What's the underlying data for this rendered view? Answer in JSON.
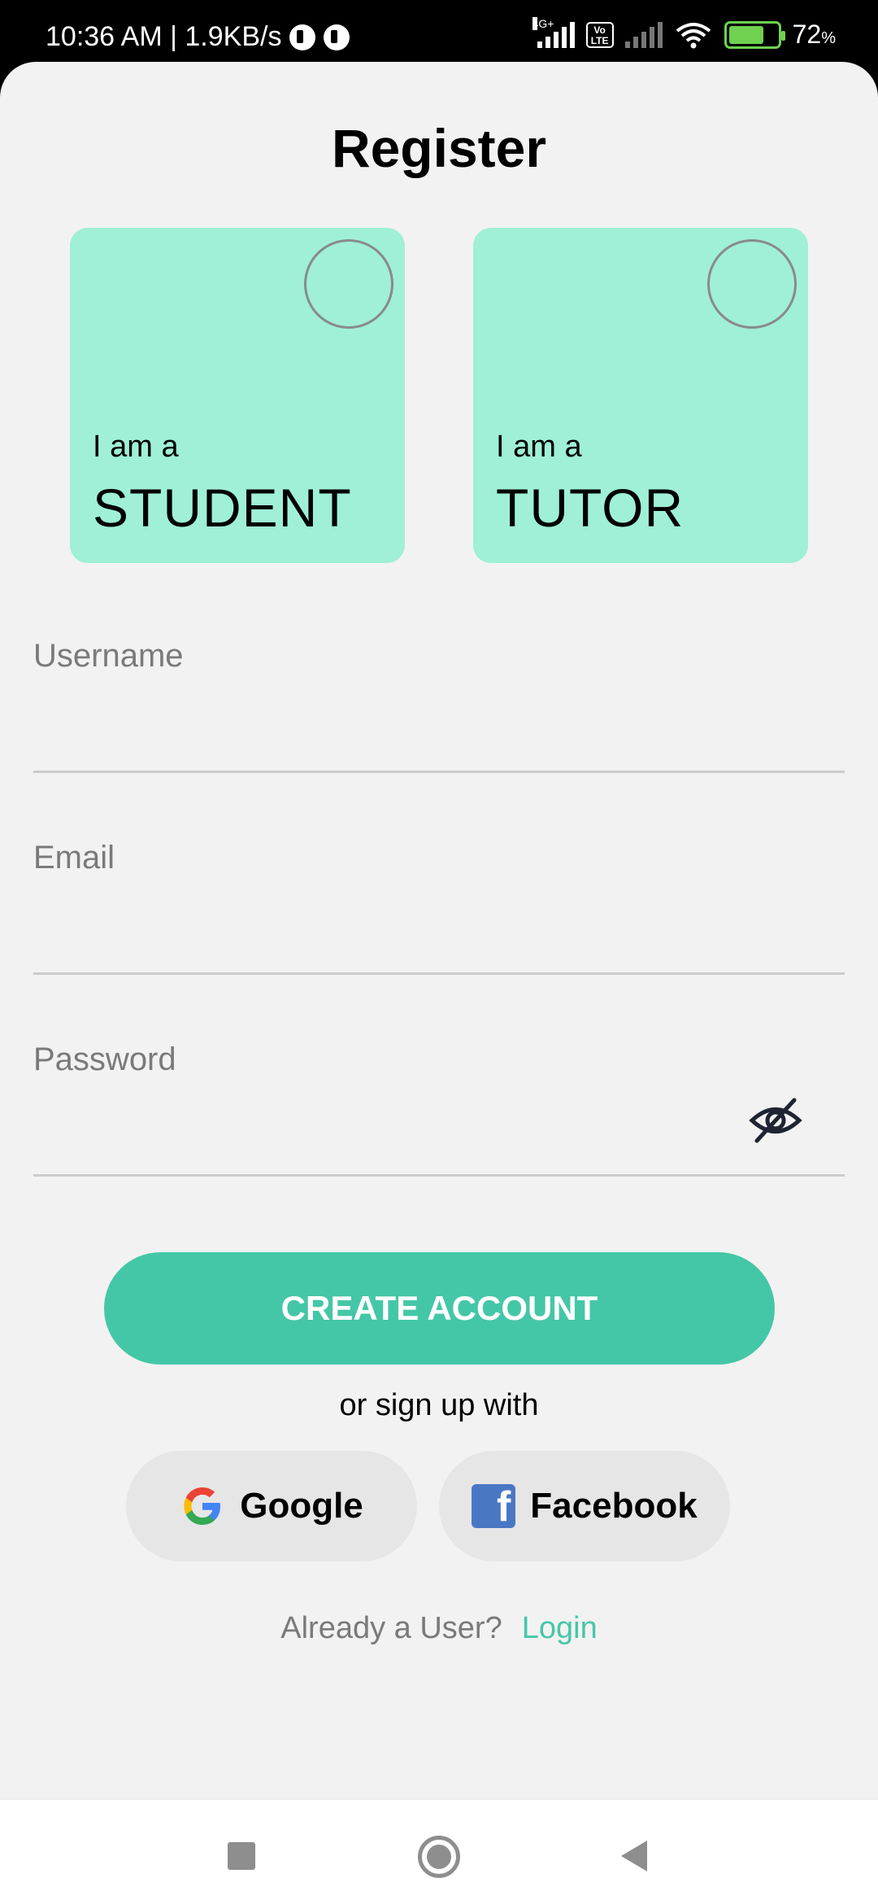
{
  "status_bar": {
    "time_speed": "10:36 AM | 1.9KB/s",
    "network_type": "4G+",
    "volte": "Vo LTE",
    "battery_percent": "72",
    "battery_unit": "%"
  },
  "page": {
    "title": "Register"
  },
  "roles": [
    {
      "prefix": "I am a",
      "label": "STUDENT"
    },
    {
      "prefix": "I am a",
      "label": "TUTOR"
    }
  ],
  "form": {
    "username_label": "Username",
    "username_value": "",
    "email_label": "Email",
    "email_value": "",
    "password_label": "Password",
    "password_value": ""
  },
  "actions": {
    "create_label": "CREATE ACCOUNT",
    "or_text": "or sign up with",
    "google_label": "Google",
    "facebook_label": "Facebook",
    "already_text": "Already a User?",
    "login_label": "Login"
  },
  "colors": {
    "accent": "#44c7a7",
    "card": "#9ff0d6",
    "background": "#f2f2f2"
  }
}
